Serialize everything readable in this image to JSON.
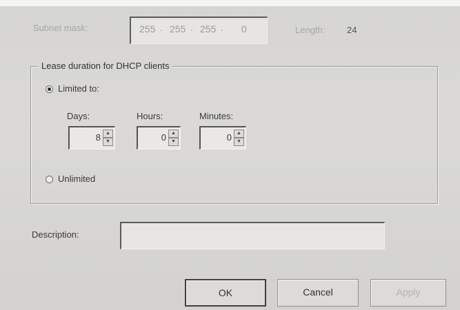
{
  "subnet": {
    "label": "Subnet mask:",
    "octets": [
      "255",
      "255",
      "255",
      "0"
    ],
    "length_label": "Length:",
    "length_value": "24"
  },
  "lease": {
    "group_title": "Lease duration for DHCP clients",
    "limited_label": "Limited to:",
    "limited_selected": true,
    "days_label": "Days:",
    "hours_label": "Hours:",
    "minutes_label": "Minutes:",
    "days_value": "8",
    "hours_value": "0",
    "minutes_value": "0",
    "unlimited_label": "Unlimited",
    "unlimited_selected": false
  },
  "description": {
    "label": "Description:",
    "value": ""
  },
  "buttons": {
    "ok": "OK",
    "cancel": "Cancel",
    "apply": "Apply"
  }
}
